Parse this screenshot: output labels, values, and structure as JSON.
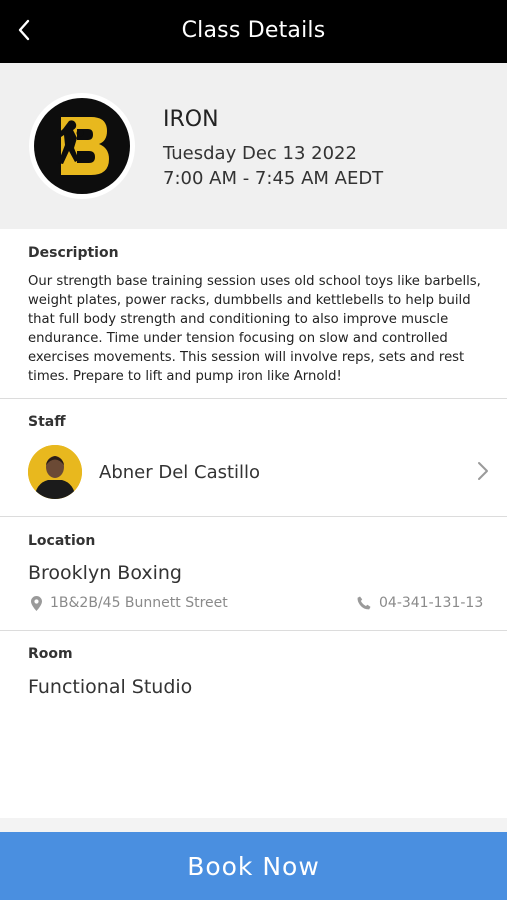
{
  "header": {
    "title": "Class Details",
    "back_icon": "chevron-left-icon"
  },
  "class": {
    "name": "IRON",
    "date": "Tuesday Dec 13 2022",
    "time": "7:00 AM - 7:45 AM AEDT",
    "logo_icon": "boxer-b-logo"
  },
  "description": {
    "label": "Description",
    "text": "Our strength base training session uses old school toys like barbells, weight plates, power racks, dumbbells and kettlebells to help build that full body strength and conditioning to also improve muscle endurance. Time under tension focusing on slow and controlled exercises movements. This session will involve reps, sets and rest times. Prepare to lift and pump iron like Arnold!"
  },
  "staff": {
    "label": "Staff",
    "name": "Abner Del Castillo"
  },
  "location": {
    "label": "Location",
    "name": "Brooklyn Boxing",
    "address": "1B&2B/45 Bunnett Street",
    "phone": "04-341-131-13"
  },
  "room": {
    "label": "Room",
    "name": "Functional Studio"
  },
  "actions": {
    "book_label": "Book Now"
  },
  "colors": {
    "header_bg": "#000000",
    "accent": "#4a8fe0",
    "logo_gold": "#e8b81e"
  }
}
